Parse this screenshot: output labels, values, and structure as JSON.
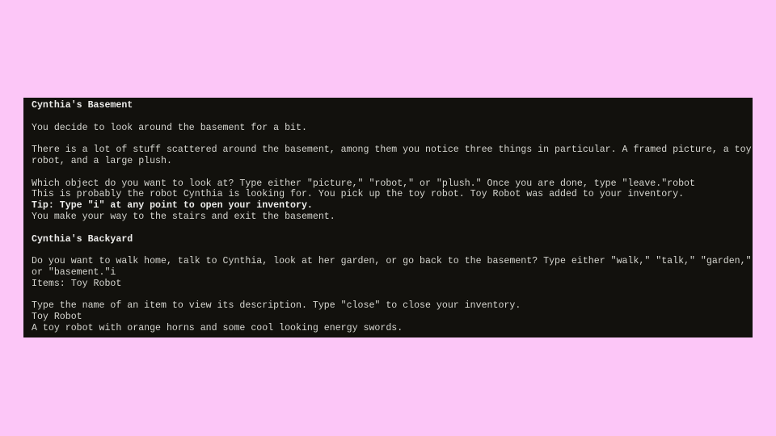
{
  "terminal": {
    "lines": [
      {
        "text": "Cynthia's Basement",
        "style": "bold"
      },
      {
        "text": "",
        "style": "blank"
      },
      {
        "text": "You decide to look around the basement for a bit.",
        "style": "normal"
      },
      {
        "text": "",
        "style": "blank"
      },
      {
        "text": "There is a lot of stuff scattered around the basement, among them you notice three things in particular. A framed picture, a toy",
        "style": "normal"
      },
      {
        "text": "robot, and a large plush.",
        "style": "normal"
      },
      {
        "text": "",
        "style": "blank"
      },
      {
        "text": "Which object do you want to look at? Type either \"picture,\" \"robot,\" or \"plush.\" Once you are done, type \"leave.\"robot",
        "style": "normal"
      },
      {
        "text": "This is probably the robot Cynthia is looking for. You pick up the toy robot. Toy Robot was added to your inventory.",
        "style": "normal"
      },
      {
        "text": "Tip: Type \"i\" at any point to open your inventory.",
        "style": "bold"
      },
      {
        "text": "You make your way to the stairs and exit the basement.",
        "style": "normal"
      },
      {
        "text": "",
        "style": "blank"
      },
      {
        "text": "Cynthia's Backyard",
        "style": "bold"
      },
      {
        "text": "",
        "style": "blank"
      },
      {
        "text": "Do you want to walk home, talk to Cynthia, look at her garden, or go back to the basement? Type either \"walk,\" \"talk,\" \"garden,\"",
        "style": "normal"
      },
      {
        "text": "or \"basement.\"i",
        "style": "normal"
      },
      {
        "text": "Items: Toy Robot",
        "style": "normal"
      },
      {
        "text": "",
        "style": "blank"
      },
      {
        "text": "Type the name of an item to view its description. Type \"close\" to close your inventory.",
        "style": "normal"
      },
      {
        "text": "Toy Robot",
        "style": "normal"
      },
      {
        "text": "A toy robot with orange horns and some cool looking energy swords.",
        "style": "normal"
      }
    ]
  },
  "colors": {
    "page_background": "#fcc6f7",
    "terminal_background": "#12110d",
    "terminal_text": "#d6d6d0"
  }
}
